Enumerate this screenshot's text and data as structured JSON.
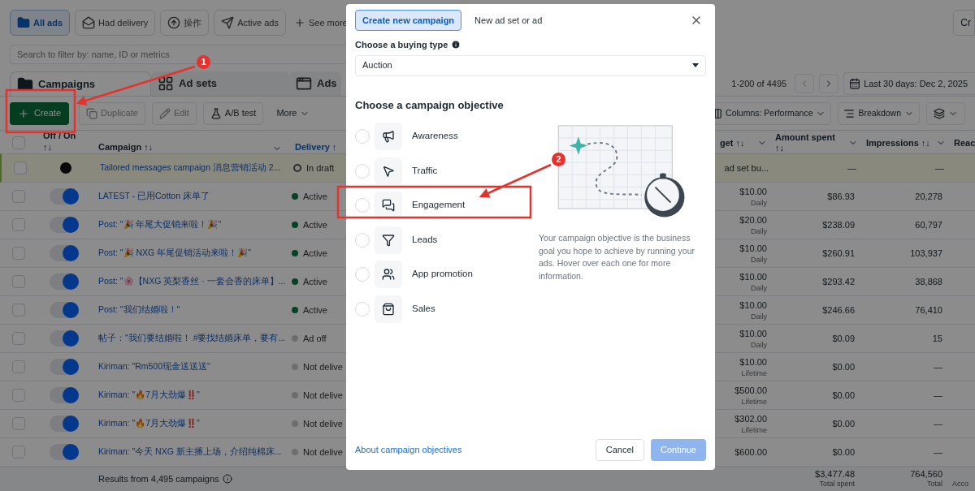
{
  "filters": [
    {
      "label": "All ads",
      "selected": true
    },
    {
      "label": "Had delivery",
      "selected": false
    },
    {
      "label": "操作",
      "selected": false
    },
    {
      "label": "Active ads",
      "selected": false
    }
  ],
  "see_more": "See more",
  "corner_button": "Cr",
  "search": {
    "placeholder": "Search to filter by: name, ID or metrics"
  },
  "level_tabs": [
    {
      "label": "Campaigns",
      "kind": "campaigns",
      "selected": true
    },
    {
      "label": "Ad sets",
      "kind": "adsets",
      "selected": false
    },
    {
      "label": "Ads",
      "kind": "ads",
      "selected": false
    }
  ],
  "pagination": "1-200 of 4495",
  "date_range": "Last 30 days: Dec 2, 2025",
  "toolbar": {
    "create": "Create",
    "actions": [
      {
        "label": "Duplicate",
        "kind": "duplicate",
        "disabled": true
      },
      {
        "label": "Edit",
        "kind": "edit",
        "disabled": true
      },
      {
        "label": "A/B test",
        "kind": "abtest",
        "disabled": false
      }
    ],
    "more": "More",
    "columns": "Columns: Performance",
    "breakdown": "Breakdown"
  },
  "table": {
    "all_selected": false,
    "columns": [
      {
        "label": "Off / On ↑↓",
        "sorted": false,
        "has_menu": false
      },
      {
        "label": "Campaign ↑↓",
        "sorted": false,
        "has_menu": true
      },
      {
        "label": "Delivery ↑",
        "sorted": true,
        "has_menu": false
      },
      {
        "label": "get ↑↓",
        "sorted": false,
        "has_menu": true
      },
      {
        "label": "Amount spent ↑↓",
        "sorted": false,
        "has_menu": true
      },
      {
        "label": "Impressions ↑↓",
        "sorted": false,
        "has_menu": true
      },
      {
        "label": "Reac",
        "sorted": false,
        "has_menu": false
      }
    ],
    "rows": [
      {
        "selected": false,
        "on": false,
        "highlighted": true,
        "name": "Tailored messages campaign 消息营销活动 2...",
        "delivery": {
          "kind": "draft",
          "label": "In draft"
        },
        "budget": "ad set bu...",
        "amount_spent": "—",
        "impressions": "—"
      },
      {
        "selected": false,
        "on": true,
        "highlighted": false,
        "name": "LATEST - 已用Cotton 床单了",
        "delivery": {
          "kind": "active",
          "label": "Active"
        },
        "budget": "$10.00",
        "budget_period": "Daily",
        "amount_spent": "$86.93",
        "impressions": "20,278"
      },
      {
        "selected": false,
        "on": true,
        "highlighted": false,
        "name": "Post: \"🎉 年尾大促销来啦！🎉\"",
        "delivery": {
          "kind": "active",
          "label": "Active"
        },
        "budget": "$20.00",
        "budget_period": "Daily",
        "amount_spent": "$238.09",
        "impressions": "60,797"
      },
      {
        "selected": false,
        "on": true,
        "highlighted": false,
        "name": "Post: \"🎉 NXG 年尾促销活动来啦！🎉\"",
        "delivery": {
          "kind": "active",
          "label": "Active"
        },
        "budget": "$10.00",
        "budget_period": "Daily",
        "amount_spent": "$260.91",
        "impressions": "103,937"
      },
      {
        "selected": false,
        "on": true,
        "highlighted": false,
        "name": "Post: \"🌸【NXG 英梨香丝 · 一套会香的床单】...",
        "delivery": {
          "kind": "active",
          "label": "Active"
        },
        "budget": "$10.00",
        "budget_period": "Daily",
        "amount_spent": "$293.42",
        "impressions": "38,868"
      },
      {
        "selected": false,
        "on": true,
        "highlighted": false,
        "name": "Post: \"我们结婚啦！\"",
        "delivery": {
          "kind": "active",
          "label": "Active"
        },
        "budget": "$10.00",
        "budget_period": "Daily",
        "amount_spent": "$246.66",
        "impressions": "76,410"
      },
      {
        "selected": false,
        "on": true,
        "highlighted": false,
        "name": "帖子：\"我们要结婚啦！ #要找结婚床单，要有...",
        "delivery": {
          "kind": "off",
          "label": "Ad off"
        },
        "budget": "$10.00",
        "budget_period": "Daily",
        "amount_spent": "$0.09",
        "impressions": "15"
      },
      {
        "selected": false,
        "on": true,
        "highlighted": false,
        "name": "Kiriman: \"Rm500现金送送送\"",
        "delivery": {
          "kind": "off",
          "label": "Not delive"
        },
        "budget": "$10.00",
        "budget_period": "Lifetime",
        "amount_spent": "$0.00",
        "impressions": "—"
      },
      {
        "selected": false,
        "on": true,
        "highlighted": false,
        "name": "Kiriman: \"🔥7月大劲爆‼️\"",
        "delivery": {
          "kind": "off",
          "label": "Not delive"
        },
        "budget": "$500.00",
        "budget_period": "Lifetime",
        "amount_spent": "$0.00",
        "impressions": "—"
      },
      {
        "selected": false,
        "on": true,
        "highlighted": false,
        "name": "Kiriman: \"🔥7月大劲爆‼️\"",
        "delivery": {
          "kind": "off",
          "label": "Not delive"
        },
        "budget": "$302.00",
        "budget_period": "Lifetime",
        "amount_spent": "$0.00",
        "impressions": "—"
      },
      {
        "selected": false,
        "on": true,
        "highlighted": false,
        "name": "Kiriman: \"今天 NXG 新主播上场，介绍纯棉床...",
        "delivery": {
          "kind": "off",
          "label": "Not delive"
        },
        "budget": "$600.00",
        "amount_spent": "$0.00",
        "impressions": "—"
      }
    ],
    "footer": {
      "results": "Results from 4,495 campaigns",
      "totals": [
        {
          "value": "$3,477.48",
          "label": "Total spent"
        },
        {
          "value": "764,560",
          "label": "Total"
        }
      ],
      "reach_label": "Acco"
    }
  },
  "dialog": {
    "tabs": [
      {
        "label": "Create new campaign",
        "selected": true
      },
      {
        "label": "New ad set or ad",
        "selected": false
      }
    ],
    "buying_type": {
      "label": "Choose a buying type",
      "value": "Auction"
    },
    "objective_heading": "Choose a campaign objective",
    "objectives": [
      {
        "kind": "awareness",
        "label": "Awareness",
        "selected": false
      },
      {
        "kind": "traffic",
        "label": "Traffic",
        "selected": false
      },
      {
        "kind": "engagement",
        "label": "Engagement",
        "selected": false
      },
      {
        "kind": "leads",
        "label": "Leads",
        "selected": false
      },
      {
        "kind": "app",
        "label": "App promotion",
        "selected": false
      },
      {
        "kind": "sales",
        "label": "Sales",
        "selected": false
      }
    ],
    "description": "Your campaign objective is the business goal you hope to achieve by running your ads. Hover over each one for more information.",
    "link": "About campaign objectives",
    "buttons": [
      {
        "label": "Cancel",
        "kind": "secondary",
        "disabled": false
      },
      {
        "label": "Continue",
        "kind": "primary",
        "disabled": true
      }
    ]
  },
  "badges": [
    "1",
    "2"
  ]
}
